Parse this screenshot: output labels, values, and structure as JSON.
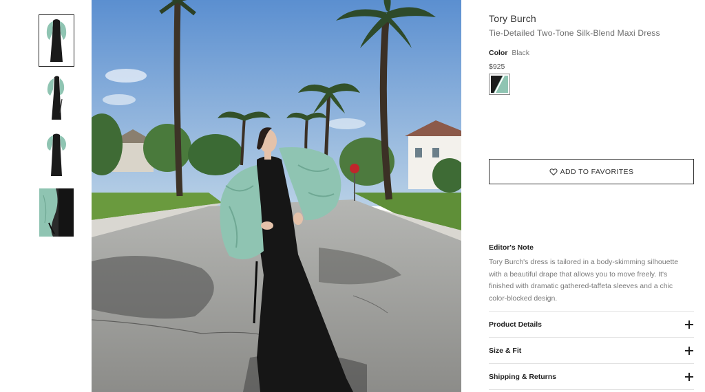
{
  "gallery": {
    "thumbnails": [
      {
        "icon": "dress-front-thumbnail",
        "active": true
      },
      {
        "icon": "dress-side-thumbnail",
        "active": false
      },
      {
        "icon": "dress-back-thumbnail",
        "active": false
      },
      {
        "icon": "sleeve-detail-thumbnail",
        "active": false
      }
    ],
    "main_image": "woman-in-two-tone-dress-on-palm-street"
  },
  "product": {
    "brand": "Tory Burch",
    "name": "Tie-Detailed Two-Tone Silk-Blend Maxi Dress",
    "color_label": "Color",
    "color_value": "Black",
    "price": "$925",
    "swatch_colors": [
      "#1c1c1c",
      "#8fc4b2"
    ]
  },
  "actions": {
    "favorites_label": "ADD TO FAVORITES",
    "favorites_icon": "heart-icon"
  },
  "editors_note": {
    "title": "Editor's Note",
    "body": "Tory Burch's dress is tailored in a body-skimming silhouette with a beautiful drape that allows you to move freely. It's finished with dramatic gathered-taffeta sleeves and a chic color-blocked design."
  },
  "accordions": [
    {
      "label": "Product Details",
      "icon": "plus-icon"
    },
    {
      "label": "Size & Fit",
      "icon": "plus-icon"
    },
    {
      "label": "Shipping & Returns",
      "icon": "plus-icon"
    }
  ],
  "colors": {
    "dress_black": "#1a1a1a",
    "sleeve_mint": "#8fc4b2",
    "sky": "#7fa9d4",
    "road": "#9a9a98",
    "text_muted": "#7a7a7a"
  }
}
